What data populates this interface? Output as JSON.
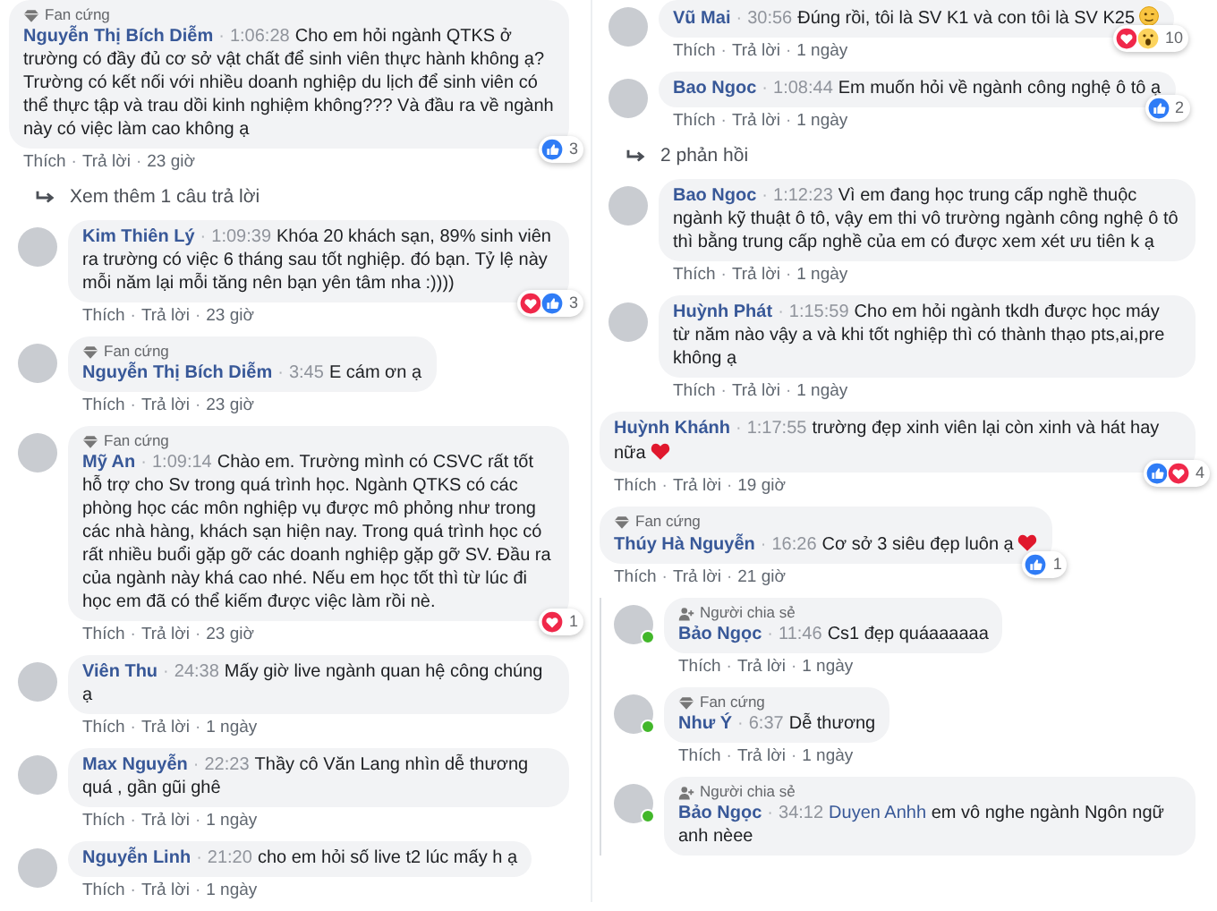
{
  "columns": [
    {
      "items": [
        {
          "kind": "comment",
          "avatar": false,
          "badge": {
            "kind": "fan",
            "label": "Fan cứng"
          },
          "author": "Nguyễn Thị Bích Diễm",
          "sep": "·",
          "time": "1:06:28",
          "text": "Cho em hỏi ngành QTKS ở trường có đầy đủ cơ sở vật chất để sinh viên thực hành không ạ? Trường có kết nối với nhiều doanh nghiệp du lịch để sinh viên có thể thực tập và trau dồi kinh nghiệm không??? Và đầu ra về ngành này có việc làm cao không ạ",
          "reactions": {
            "icons": [
              {
                "kind": "like"
              }
            ],
            "count": "3"
          },
          "actions": [
            "Thích",
            "·",
            "Trả lời",
            "·",
            "23 giờ"
          ]
        },
        {
          "kind": "more",
          "label": "Xem thêm 1 câu trả lời"
        },
        {
          "kind": "comment",
          "avatar": true,
          "online": false,
          "author": "Kim Thiên Lý",
          "sep": "·",
          "time": "1:09:39",
          "text": "Khóa 20 khách sạn, 89% sinh viên ra trường có việc 6 tháng sau tốt nghiệp. đó bạn. Tỷ lệ này mỗi năm lại mỗi tăng nên bạn yên tâm nha :))))",
          "reactions": {
            "icons": [
              {
                "kind": "love"
              },
              {
                "kind": "like"
              }
            ],
            "count": "3"
          },
          "actions": [
            "Thích",
            "·",
            "Trả lời",
            "·",
            "23 giờ"
          ]
        },
        {
          "kind": "comment",
          "avatar": true,
          "online": false,
          "badge": {
            "kind": "fan",
            "label": "Fan cứng"
          },
          "author": "Nguyễn Thị Bích Diễm",
          "sep": "·",
          "time": "3:45",
          "text": "E cám ơn ạ",
          "actions": [
            "Thích",
            "·",
            "Trả lời",
            "·",
            "23 giờ"
          ]
        },
        {
          "kind": "comment",
          "avatar": true,
          "online": false,
          "badge": {
            "kind": "fan",
            "label": "Fan cứng"
          },
          "author": "Mỹ An",
          "sep": "·",
          "time": "1:09:14",
          "text": "Chào em. Trường mình có CSVC rất tốt hỗ trợ cho Sv trong quá trình học. Ngành QTKS có các phòng học các môn nghiệp vụ được mô phỏng như trong các nhà hàng, khách sạn hiện nay. Trong quá trình học có rất nhiều buổi gặp gỡ các doanh nghiệp gặp gỡ SV. Đầu ra của ngành này khá cao nhé. Nếu em học tốt thì từ lúc đi học em đã có thể kiếm được việc làm rồi nè.",
          "reactions": {
            "icons": [
              {
                "kind": "love"
              }
            ],
            "count": "1"
          },
          "actions": [
            "Thích",
            "·",
            "Trả lời",
            "·",
            "23 giờ"
          ]
        },
        {
          "kind": "comment",
          "avatar": true,
          "online": false,
          "author": "Viên Thu",
          "sep": "·",
          "time": "24:38",
          "text": "Mấy giờ live ngành quan hệ công chúng ạ",
          "actions": [
            "Thích",
            "·",
            "Trả lời",
            "·",
            "1 ngày"
          ]
        },
        {
          "kind": "comment",
          "avatar": true,
          "online": false,
          "author": "Max Nguyễn",
          "sep": "·",
          "time": "22:23",
          "text": "Thầy cô Văn Lang nhìn dễ thương quá , gần gũi ghê",
          "actions": [
            "Thích",
            "·",
            "Trả lời",
            "·",
            "1 ngày"
          ]
        },
        {
          "kind": "comment",
          "avatar": true,
          "online": false,
          "author": "Nguyễn Linh",
          "sep": "·",
          "time": "21:20",
          "text": "cho em hỏi số live t2 lúc mấy h ạ",
          "actions": [
            "Thích",
            "·",
            "Trả lời",
            "·",
            "1 ngày"
          ]
        }
      ]
    },
    {
      "items": [
        {
          "kind": "comment",
          "avatar": true,
          "online": false,
          "author": "Vũ Mai",
          "sep": "·",
          "time": "30:56",
          "text": "Đúng rồi, tôi là SV K1 và con tôi là SV K25",
          "emoji": {
            "kind": "wink"
          },
          "reactions": {
            "icons": [
              {
                "kind": "love"
              },
              {
                "kind": "wow"
              }
            ],
            "count": "10"
          },
          "actions": [
            "Thích",
            "·",
            "Trả lời",
            "·",
            "1 ngày"
          ]
        },
        {
          "kind": "comment",
          "avatar": true,
          "online": false,
          "author": "Bao Ngoc",
          "sep": "·",
          "time": "1:08:44",
          "text": "Em muốn hỏi về ngành công nghệ ô tô ạ",
          "reactions": {
            "icons": [
              {
                "kind": "like"
              }
            ],
            "count": "2"
          },
          "actions": [
            "Thích",
            "·",
            "Trả lời",
            "·",
            "1 ngày"
          ]
        },
        {
          "kind": "more",
          "label": "2 phản hồi"
        },
        {
          "kind": "comment",
          "avatar": true,
          "online": false,
          "author": "Bao Ngoc",
          "sep": "·",
          "time": "1:12:23",
          "text": "Vì em đang học trung cấp nghề thuộc ngành kỹ thuật ô tô, vậy em thi vô trường ngành công nghệ ô tô thì bằng trung cấp nghề của em có được xem xét ưu tiên k ạ",
          "actions": [
            "Thích",
            "·",
            "Trả lời",
            "·",
            "1 ngày"
          ]
        },
        {
          "kind": "comment",
          "avatar": true,
          "online": false,
          "author": "Huỳnh Phát",
          "sep": "·",
          "time": "1:15:59",
          "text": "Cho em hỏi ngành tkdh được học máy từ năm nào vậy a và khi tốt nghiệp thì có thành thạo pts,ai,pre không ạ",
          "actions": [
            "Thích",
            "·",
            "Trả lời",
            "·",
            "1 ngày"
          ]
        },
        {
          "kind": "comment",
          "avatar": false,
          "author": "Huỳnh Khánh",
          "sep": "·",
          "time": "1:17:55",
          "text": "trường đẹp xinh viên lại còn xinh và hát hay nữa",
          "emoji": {
            "kind": "heart"
          },
          "reactions": {
            "icons": [
              {
                "kind": "like"
              },
              {
                "kind": "love"
              }
            ],
            "count": "4"
          },
          "actions": [
            "Thích",
            "·",
            "Trả lời",
            "·",
            "19 giờ"
          ]
        },
        {
          "kind": "comment",
          "avatar": false,
          "badge": {
            "kind": "fan",
            "label": "Fan cứng"
          },
          "author": "Thúy Hà Nguyễn",
          "sep": "·",
          "time": "16:26",
          "text": "Cơ sở 3 siêu đẹp luôn ạ",
          "emoji": {
            "kind": "heart"
          },
          "reactions": {
            "icons": [
              {
                "kind": "like"
              }
            ],
            "count": "1"
          },
          "actions": [
            "Thích",
            "·",
            "Trả lời",
            "·",
            "21 giờ"
          ],
          "children": [
            {
              "kind": "comment",
              "avatar": true,
              "online": true,
              "badge": {
                "kind": "sharer",
                "label": "Người chia sẻ"
              },
              "author": "Bảo Ngọc",
              "sep": "·",
              "time": "11:46",
              "text": "Cs1 đẹp quáaaaaaa",
              "actions": [
                "Thích",
                "·",
                "Trả lời",
                "·",
                "1 ngày"
              ]
            },
            {
              "kind": "comment",
              "avatar": true,
              "online": true,
              "badge": {
                "kind": "fan",
                "label": "Fan cứng"
              },
              "author": "Như Ý",
              "sep": "·",
              "time": "6:37",
              "text": "Dễ thương",
              "actions": [
                "Thích",
                "·",
                "Trả lời",
                "·",
                "1 ngày"
              ]
            },
            {
              "kind": "comment",
              "avatar": true,
              "online": true,
              "badge": {
                "kind": "sharer",
                "label": "Người chia sẻ"
              },
              "author": "Bảo Ngọc",
              "sep": "·",
              "time": "34:12",
              "mention": "Duyen Anhh",
              "text": "em vô nghe ngành Ngôn ngữ anh nèee"
            }
          ]
        }
      ]
    }
  ]
}
